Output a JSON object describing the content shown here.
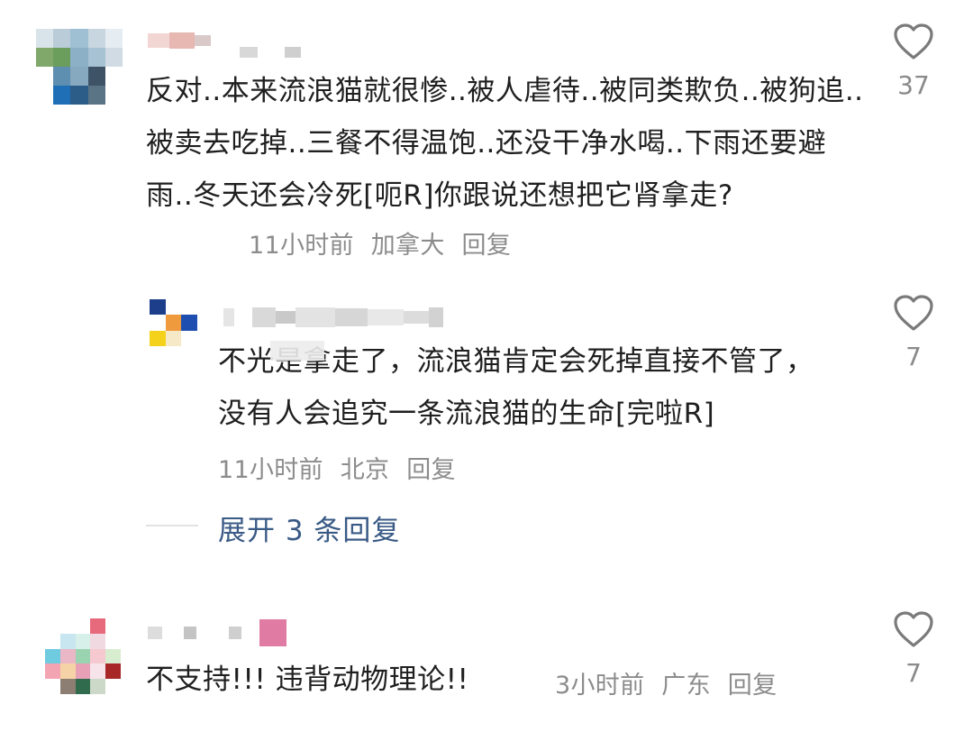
{
  "comments": [
    {
      "text": "反对..本来流浪猫就很惨..被人虐待..被同类欺负..被狗追..被卖去吃掉..三餐不得温饱..还没干净水喝..下雨还要避雨..冬天还会冷死[呃R]你跟说还想把它肾拿走?",
      "time": "11小时前",
      "location": "加拿大",
      "reply_label": "回复",
      "likes": "37",
      "icon": "heart-outline-icon"
    },
    {
      "text": "不光是拿走了，流浪猫肯定会死掉直接不管了，没有人会追究一条流浪猫的生命[完啦R]",
      "time": "11小时前",
      "location": "北京",
      "reply_label": "回复",
      "likes": "7",
      "icon": "heart-outline-icon"
    },
    {
      "text": "不支持!!! 违背动物理论!!",
      "time": "3小时前",
      "location": "广东",
      "reply_label": "回复",
      "likes": "7",
      "icon": "heart-outline-icon"
    }
  ],
  "expand": {
    "label": "展开 3 条回复"
  },
  "colors": {
    "link": "#3a5a86",
    "meta": "#8c8c8c",
    "text": "#1f1f1f"
  }
}
